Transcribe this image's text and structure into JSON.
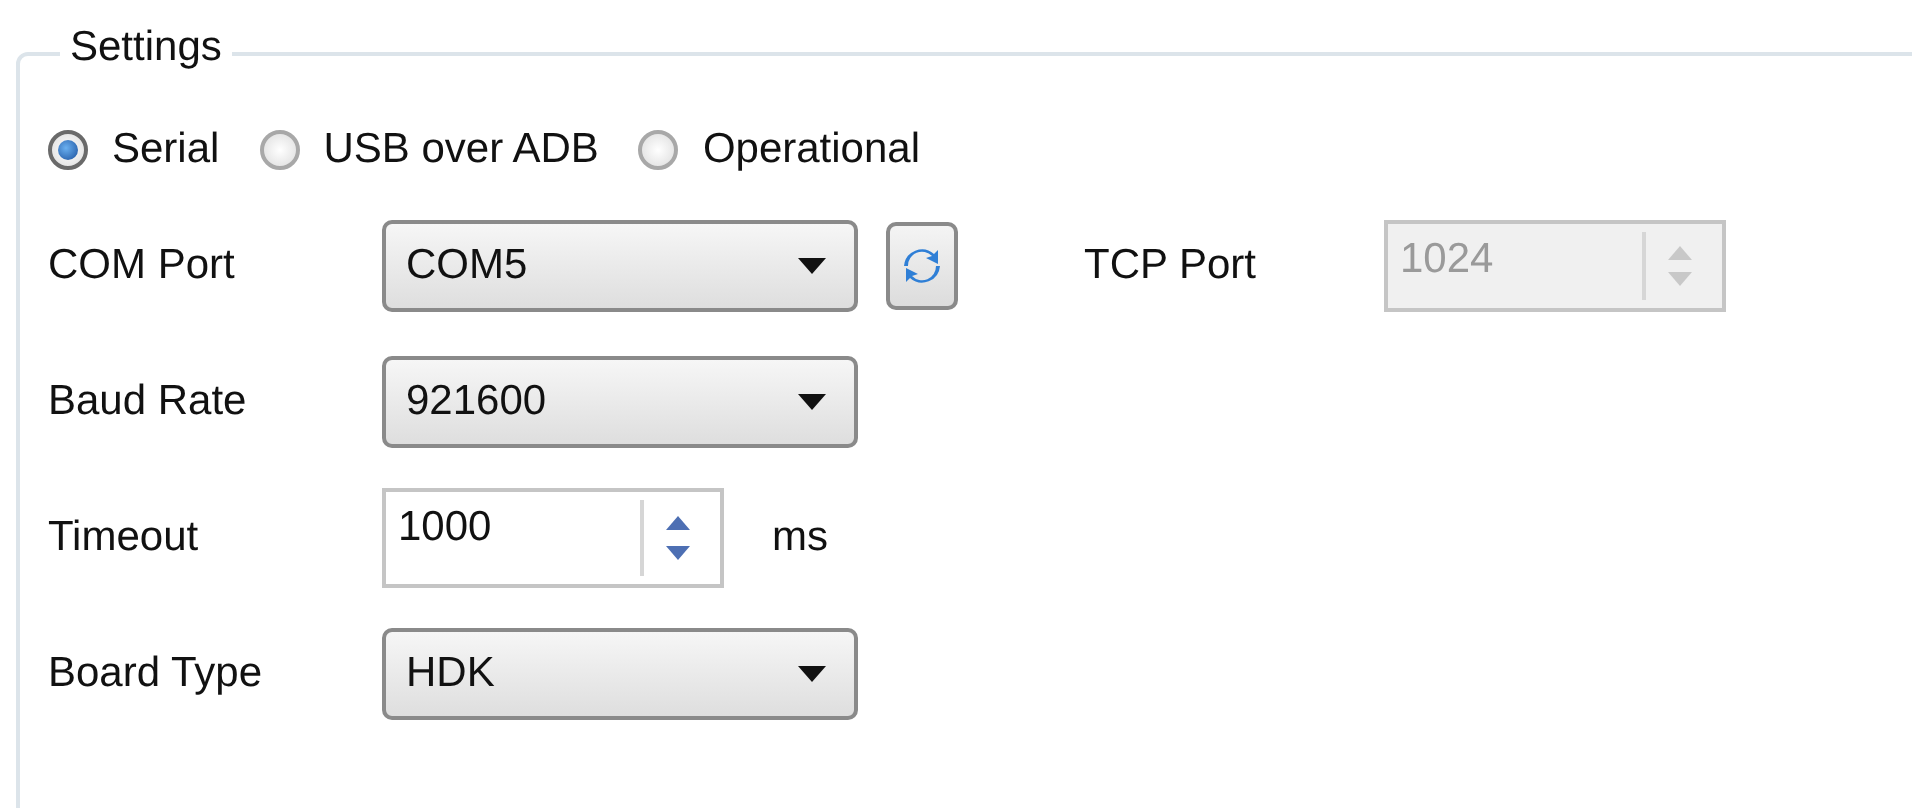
{
  "group": {
    "title": "Settings"
  },
  "modes": [
    {
      "label": "Serial",
      "selected": true
    },
    {
      "label": "USB over ADB",
      "selected": false
    },
    {
      "label": "Operational",
      "selected": false
    }
  ],
  "rows": [
    {
      "items": [
        {
          "kind": "label",
          "text": "COM Port"
        },
        {
          "kind": "combo",
          "value": "COM5"
        },
        {
          "kind": "refresh"
        },
        {
          "kind": "label",
          "text": "TCP Port"
        },
        {
          "kind": "spinner",
          "value": "1024",
          "disabled": true
        }
      ]
    },
    {
      "items": [
        {
          "kind": "label",
          "text": "Baud Rate"
        },
        {
          "kind": "combo",
          "value": "921600"
        }
      ]
    },
    {
      "items": [
        {
          "kind": "label",
          "text": "Timeout"
        },
        {
          "kind": "spinner",
          "value": "1000",
          "disabled": false
        },
        {
          "kind": "unit",
          "text": "ms"
        }
      ]
    },
    {
      "items": [
        {
          "kind": "label",
          "text": "Board Type"
        },
        {
          "kind": "combo",
          "value": "HDK"
        }
      ]
    }
  ]
}
